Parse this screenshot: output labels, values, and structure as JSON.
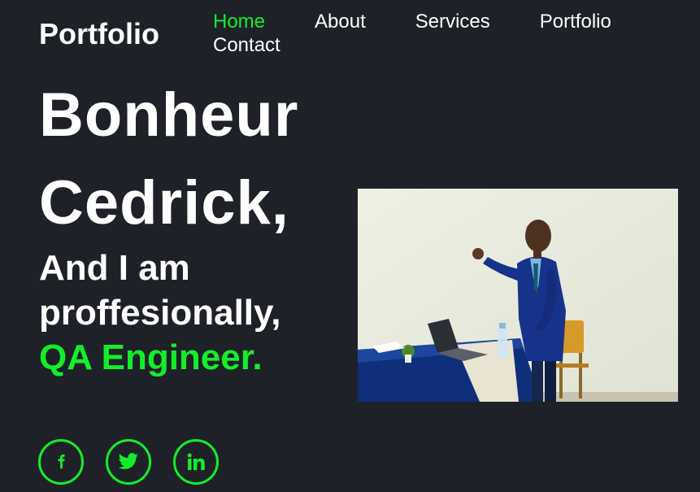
{
  "header": {
    "logo": "Portfolio",
    "nav": [
      {
        "label": "Home",
        "active": true
      },
      {
        "label": "About",
        "active": false
      },
      {
        "label": "Services",
        "active": false
      },
      {
        "label": "Portfolio",
        "active": false
      },
      {
        "label": "Contact",
        "active": false
      }
    ]
  },
  "hero": {
    "name_line1": "Bonheur",
    "name_line2": "Cedrick,",
    "intro_line1": "And I am",
    "intro_line2": "proffesionally,",
    "role": "QA Engineer."
  },
  "photo": {
    "subject": "presenter-photo"
  },
  "socials": [
    {
      "icon": "facebook-icon"
    },
    {
      "icon": "twitter-icon"
    },
    {
      "icon": "linkedin-icon"
    }
  ],
  "colors": {
    "background": "#1f2128",
    "accent": "#12ef2a",
    "text": "#ffffff"
  }
}
